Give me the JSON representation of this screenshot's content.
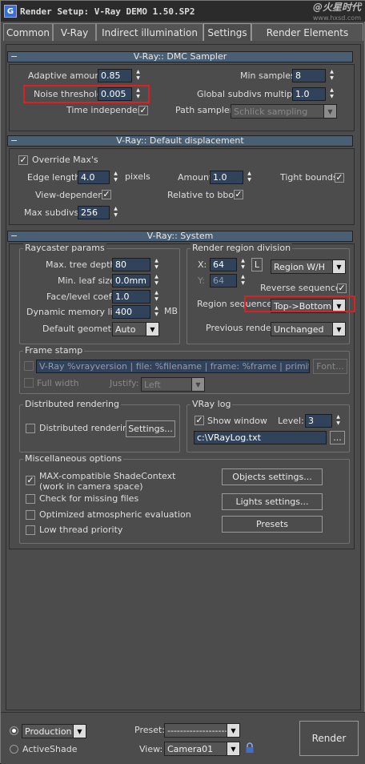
{
  "window": {
    "title": "Render Setup: V-Ray DEMO 1.50.SP2",
    "watermark": "@火星时代",
    "watermark_url": "www.hxsd.com"
  },
  "tabs": [
    "Common",
    "V-Ray",
    "Indirect illumination",
    "Settings",
    "Render Elements"
  ],
  "active_tab": "Settings",
  "dmc": {
    "title": "V-Ray:: DMC Sampler",
    "adaptive_amount_label": "Adaptive amount:",
    "adaptive_amount": "0.85",
    "noise_threshold_label": "Noise threshold:",
    "noise_threshold": "0.005",
    "time_independent_label": "Time independent",
    "time_independent_checked": "✓",
    "min_samples_label": "Min samples:",
    "min_samples": "8",
    "global_subdivs_label": "Global subdivs multiplier:",
    "global_subdivs": "1.0",
    "path_sampler_label": "Path sampler:",
    "path_sampler": "Schlick sampling"
  },
  "displacement": {
    "title": "V-Ray:: Default displacement",
    "override_label": "Override Max's",
    "override_checked": "✓",
    "edge_length_label": "Edge length",
    "edge_length": "4.0",
    "pixels_label": "pixels",
    "amount_label": "Amount",
    "amount": "1.0",
    "tight_bounds_label": "Tight bounds",
    "tight_bounds_checked": "✓",
    "view_dependent_label": "View-dependent",
    "view_dependent_checked": "✓",
    "relative_bbox_label": "Relative to bbox",
    "relative_bbox_checked": "✓",
    "max_subdivs_label": "Max subdivs",
    "max_subdivs": "256"
  },
  "system": {
    "title": "V-Ray:: System",
    "raycaster_title": "Raycaster params",
    "max_tree_depth_label": "Max. tree depth:",
    "max_tree_depth": "80",
    "min_leaf_label": "Min. leaf size:",
    "min_leaf": "0.0mm",
    "face_level_label": "Face/level coef.",
    "face_level": "1.0",
    "dyn_mem_label": "Dynamic memory limit:",
    "dyn_mem": "400",
    "mb_label": "MB",
    "default_geom_label": "Default geometry:",
    "default_geom": "Auto",
    "region_title": "Render region division",
    "x_label": "X:",
    "x_value": "64",
    "y_label": "Y:",
    "y_value": "64",
    "l_button": "L",
    "region_mode": "Region W/H",
    "reverse_label": "Reverse sequence",
    "reverse_checked": "✓",
    "region_seq_label": "Region sequence:",
    "region_seq": "Top->Bottom",
    "prev_render_label": "Previous render:",
    "prev_render": "Unchanged",
    "frame_stamp_title": "Frame stamp",
    "frame_stamp_text": "V-Ray %vrayversion | file: %filename | frame: %frame | primitives: %primitives",
    "font_button": "Font...",
    "full_width_label": "Full width",
    "justify_label": "Justify:",
    "justify_value": "Left",
    "distributed_title": "Distributed rendering",
    "distributed_label": "Distributed rendering",
    "settings_button": "Settings...",
    "vraylog_title": "VRay log",
    "show_window_label": "Show window",
    "show_window_checked": "✓",
    "level_label": "Level:",
    "level_value": "3",
    "log_path": "c:\\VRayLog.txt",
    "browse_button": "...",
    "misc_title": "Miscellaneous options",
    "max_compat_label": "MAX-compatible ShadeContext",
    "max_compat_sub": "(work in camera space)",
    "max_compat_checked": "✓",
    "check_missing_label": "Check for missing files",
    "optimized_atmo_label": "Optimized atmospheric evaluation",
    "low_thread_label": "Low thread priority",
    "objects_settings_button": "Objects settings...",
    "lights_settings_button": "Lights settings...",
    "presets_button": "Presets"
  },
  "bottom": {
    "production_label": "Production",
    "activeshade_label": "ActiveShade",
    "preset_label": "Preset:",
    "preset_value": "---------------------",
    "view_label": "View:",
    "view_value": "Camera01",
    "render_button": "Render"
  }
}
